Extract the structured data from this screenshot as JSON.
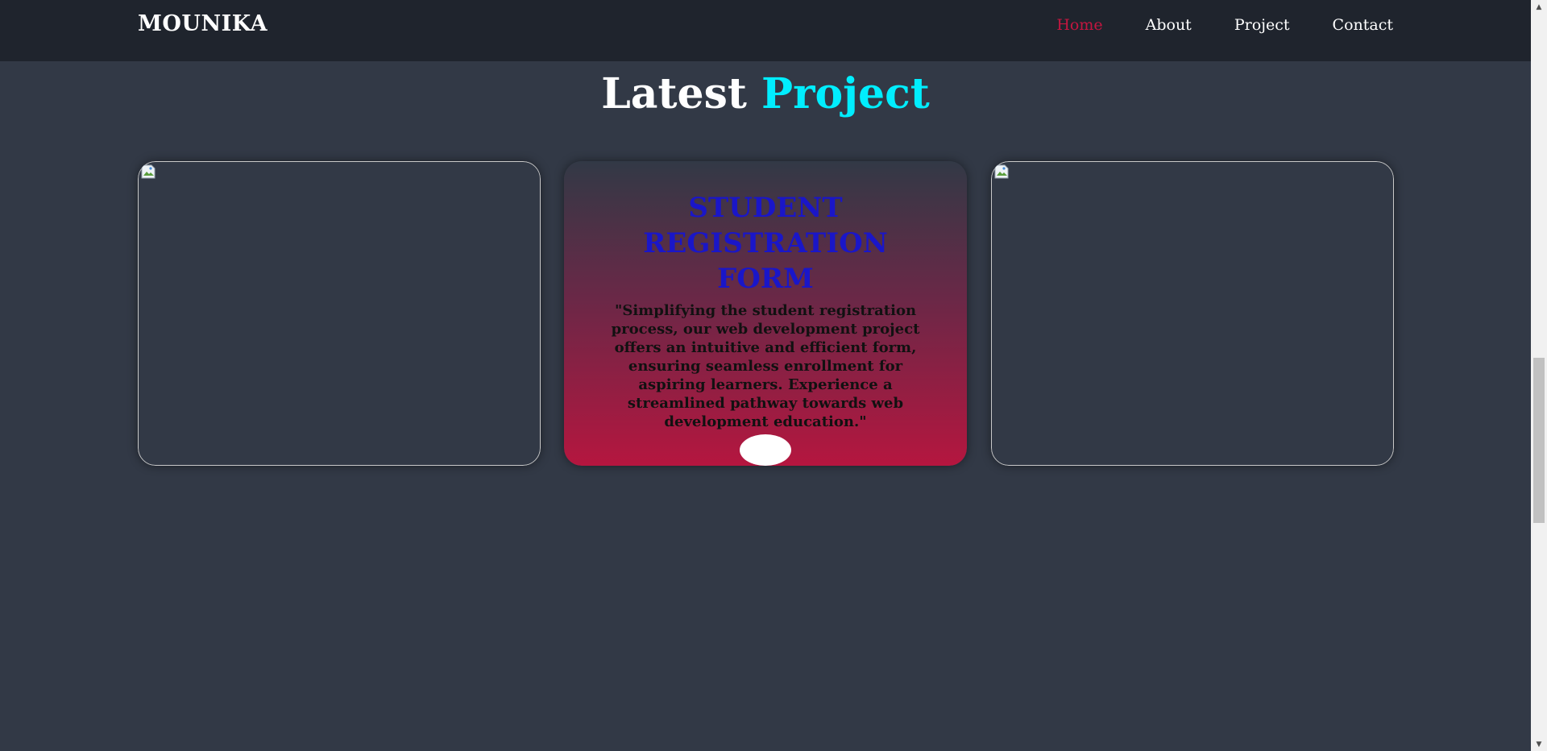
{
  "header": {
    "logo": "MOUNIKA",
    "nav": [
      {
        "label": "Home",
        "active": true
      },
      {
        "label": "About",
        "active": false
      },
      {
        "label": "Project",
        "active": false
      },
      {
        "label": "Contact",
        "active": false
      }
    ]
  },
  "section": {
    "title_main": "Latest",
    "title_accent": "Project"
  },
  "cards": [
    {
      "image_broken": true
    },
    {
      "title": "STUDENT REGISTRATION FORM",
      "description": "\"Simplifying the student registration process, our web development project offers an intuitive and efficient form, ensuring seamless enrollment for aspiring learners. Experience a streamlined pathway towards web development education.\""
    },
    {
      "image_broken": true
    }
  ],
  "colors": {
    "background": "#323946",
    "header": "#1f242d",
    "accent": "#00eeff",
    "active_nav": "#c41640",
    "card_title": "#1a16c8"
  }
}
